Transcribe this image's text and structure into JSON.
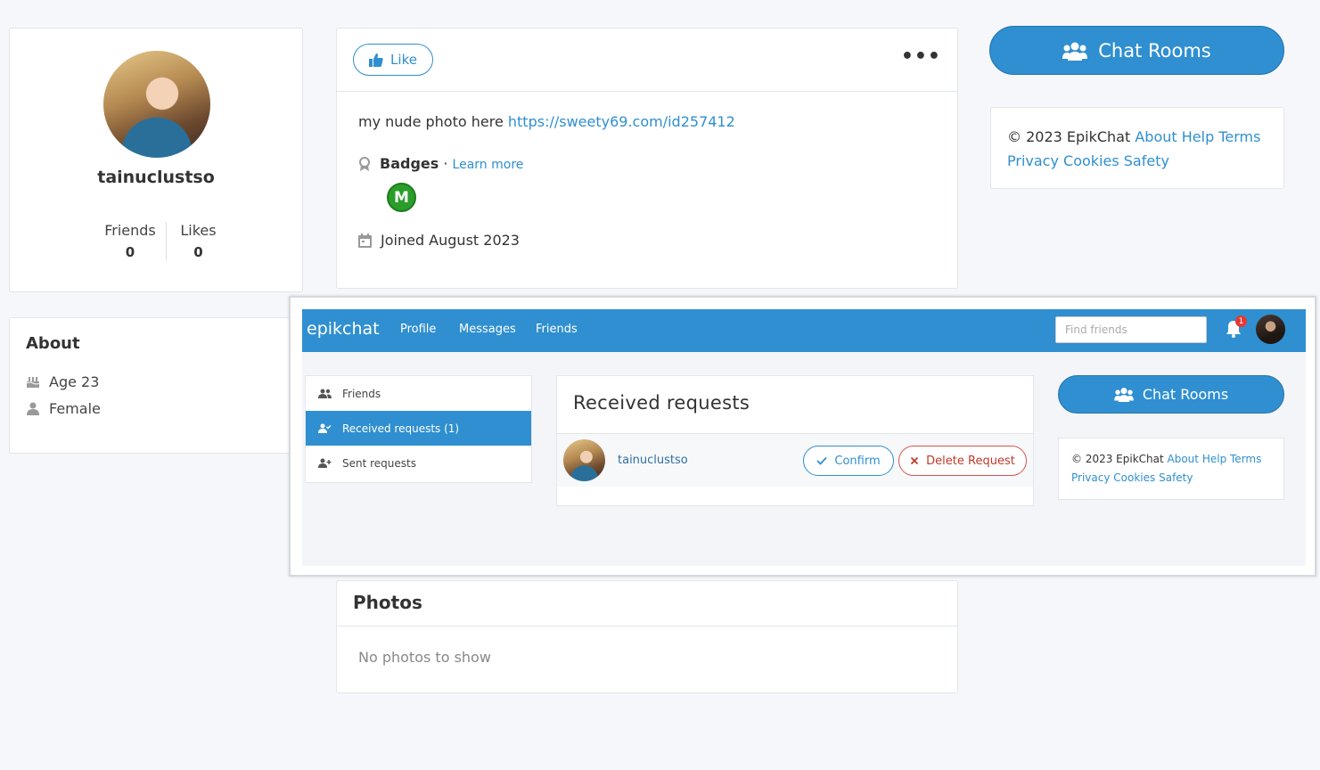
{
  "profile": {
    "username": "tainuclustso",
    "friends_label": "Friends",
    "friends_count": "0",
    "likes_label": "Likes",
    "likes_count": "0"
  },
  "about": {
    "title": "About",
    "age": "Age 23",
    "gender": "Female"
  },
  "post": {
    "like_label": "Like",
    "more_label": "•••",
    "text": "my nude photo here ",
    "link": "https://sweety69.com/id257412",
    "badges_label": "Badges",
    "badges_sep": " · ",
    "learn_more": "Learn more",
    "badge_letter": "M",
    "joined": "Joined August 2023"
  },
  "right": {
    "chat_rooms": "Chat Rooms",
    "footer": {
      "copyright": "© 2023 EpikChat ",
      "about": "About",
      "help": "Help",
      "terms": "Terms",
      "privacy": "Privacy",
      "cookies": "Cookies",
      "safety": "Safety"
    }
  },
  "photos": {
    "title": "Photos",
    "empty": "No photos to show"
  },
  "overlay": {
    "brand": "epikchat",
    "nav": {
      "profile": "Profile",
      "messages": "Messages",
      "friends": "Friends"
    },
    "search": {
      "placeholder": "Find friends"
    },
    "notification_count": "1",
    "sidebar": [
      {
        "label": "Friends"
      },
      {
        "label": "Received requests (1)"
      },
      {
        "label": "Sent requests"
      }
    ],
    "requests": {
      "title": "Received requests",
      "name": "tainuclustso",
      "confirm": "Confirm",
      "delete": "Delete Request"
    },
    "chat_rooms": "Chat Rooms",
    "footer": {
      "copyright": "© 2023 EpikChat ",
      "about": "About",
      "help": "Help",
      "terms": "Terms",
      "privacy": "Privacy",
      "cookies": "Cookies",
      "safety": "Safety"
    }
  },
  "colors": {
    "primary": "#2f8fd0",
    "danger": "#d9534f",
    "badge_green": "#2a9d2a"
  }
}
